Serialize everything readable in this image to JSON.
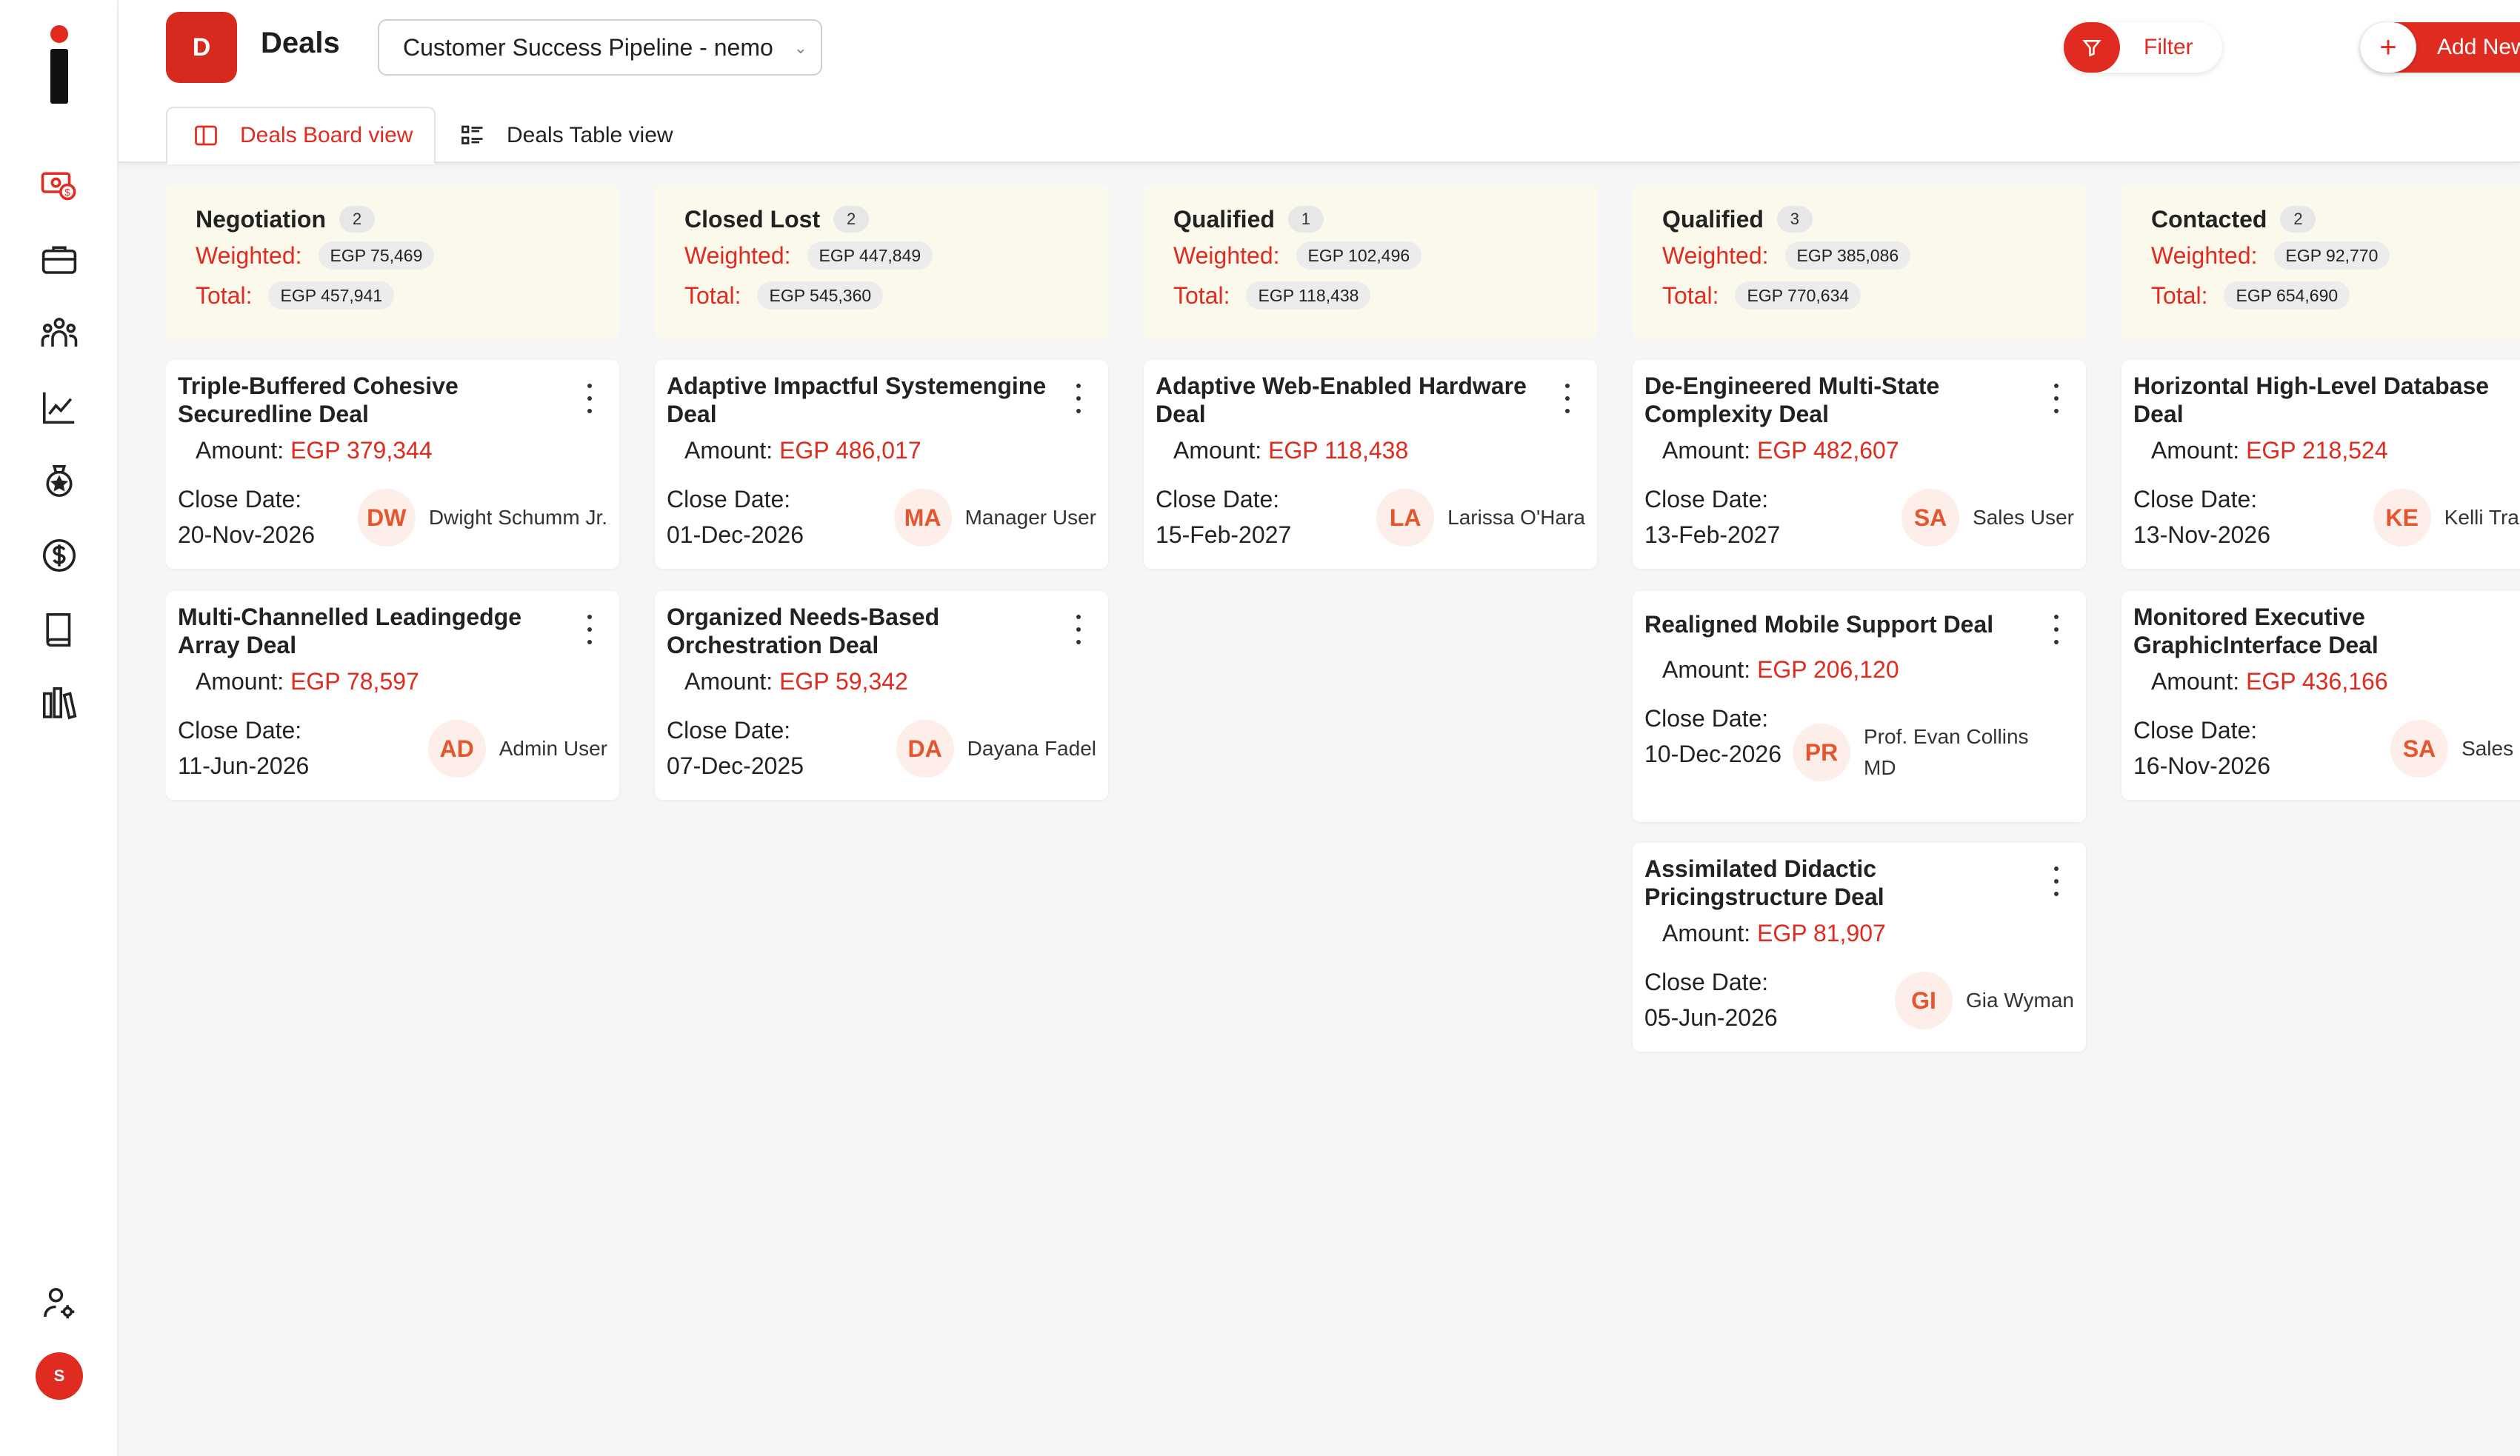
{
  "app": {
    "badge_letter": "D",
    "title": "Deals",
    "pipeline": "Customer Success Pipeline - nemo"
  },
  "toolbar": {
    "filter_label": "Filter",
    "add_label": "Add New Deal",
    "add_icon": "+"
  },
  "tabs": [
    {
      "label": "Deals Board view",
      "active": true
    },
    {
      "label": "Deals Table view",
      "active": false
    }
  ],
  "sidebar": {
    "icons": [
      "deals-money-icon",
      "briefcase-icon",
      "team-icon",
      "chart-line-icon",
      "badge-star-icon",
      "dollar-circle-icon",
      "book-icon",
      "library-icon"
    ],
    "user_settings_icon": "user-settings-icon",
    "user_initial": "S"
  },
  "colors": {
    "accent": "#e02b20",
    "column_header_bg": "#fbf8ec",
    "avatar_bg": "#fdeee9",
    "avatar_text": "#e4572e"
  },
  "labels": {
    "weighted": "Weighted:",
    "total": "Total:",
    "amount": "Amount:",
    "close_date": "Close Date:"
  },
  "columns": [
    {
      "title": "Negotiation",
      "count": "2",
      "weighted": "EGP 75,469",
      "total": "EGP 457,941",
      "cards": [
        {
          "title": "Triple-Buffered Cohesive Securedline Deal",
          "amount": "EGP 379,344",
          "close_date": "20-Nov-2026",
          "initials": "DW",
          "owner": "Dwight Schumm Jr."
        },
        {
          "title": "Multi-Channelled Leadingedge Array Deal",
          "amount": "EGP 78,597",
          "close_date": "11-Jun-2026",
          "initials": "AD",
          "owner": "Admin User"
        }
      ]
    },
    {
      "title": "Closed Lost",
      "count": "2",
      "weighted": "EGP 447,849",
      "total": "EGP 545,360",
      "cards": [
        {
          "title": "Adaptive Impactful Systemengine Deal",
          "amount": "EGP 486,017",
          "close_date": "01-Dec-2026",
          "initials": "MA",
          "owner": "Manager User"
        },
        {
          "title": "Organized Needs-Based Orchestration Deal",
          "amount": "EGP 59,342",
          "close_date": "07-Dec-2025",
          "initials": "DA",
          "owner": "Dayana Fadel"
        }
      ]
    },
    {
      "title": "Qualified",
      "count": "1",
      "weighted": "EGP 102,496",
      "total": "EGP 118,438",
      "cards": [
        {
          "title": "Adaptive Web-Enabled Hardware Deal",
          "amount": "EGP 118,438",
          "close_date": "15-Feb-2027",
          "initials": "LA",
          "owner": "Larissa O'Hara"
        }
      ]
    },
    {
      "title": "Qualified",
      "count": "3",
      "weighted": "EGP 385,086",
      "total": "EGP 770,634",
      "cards": [
        {
          "title": "De-Engineered Multi-State Complexity Deal",
          "amount": "EGP 482,607",
          "close_date": "13-Feb-2027",
          "initials": "SA",
          "owner": "Sales User"
        },
        {
          "title": "Realigned Mobile Support Deal",
          "amount": "EGP 206,120",
          "close_date": "10-Dec-2026",
          "initials": "PR",
          "owner": "Prof. Evan Collins MD"
        },
        {
          "title": "Assimilated Didactic Pricingstructure Deal",
          "amount": "EGP 81,907",
          "close_date": "05-Jun-2026",
          "initials": "GI",
          "owner": "Gia Wyman"
        }
      ]
    },
    {
      "title": "Contacted",
      "count": "2",
      "weighted": "EGP 92,770",
      "total": "EGP 654,690",
      "cards": [
        {
          "title": "Horizontal High-Level Database Deal",
          "amount": "EGP 218,524",
          "close_date": "13-Nov-2026",
          "initials": "KE",
          "owner": "Kelli Trantow"
        },
        {
          "title": "Monitored Executive GraphicInterface Deal",
          "amount": "EGP 436,166",
          "close_date": "16-Nov-2026",
          "initials": "SA",
          "owner": "Sales User"
        }
      ]
    }
  ]
}
